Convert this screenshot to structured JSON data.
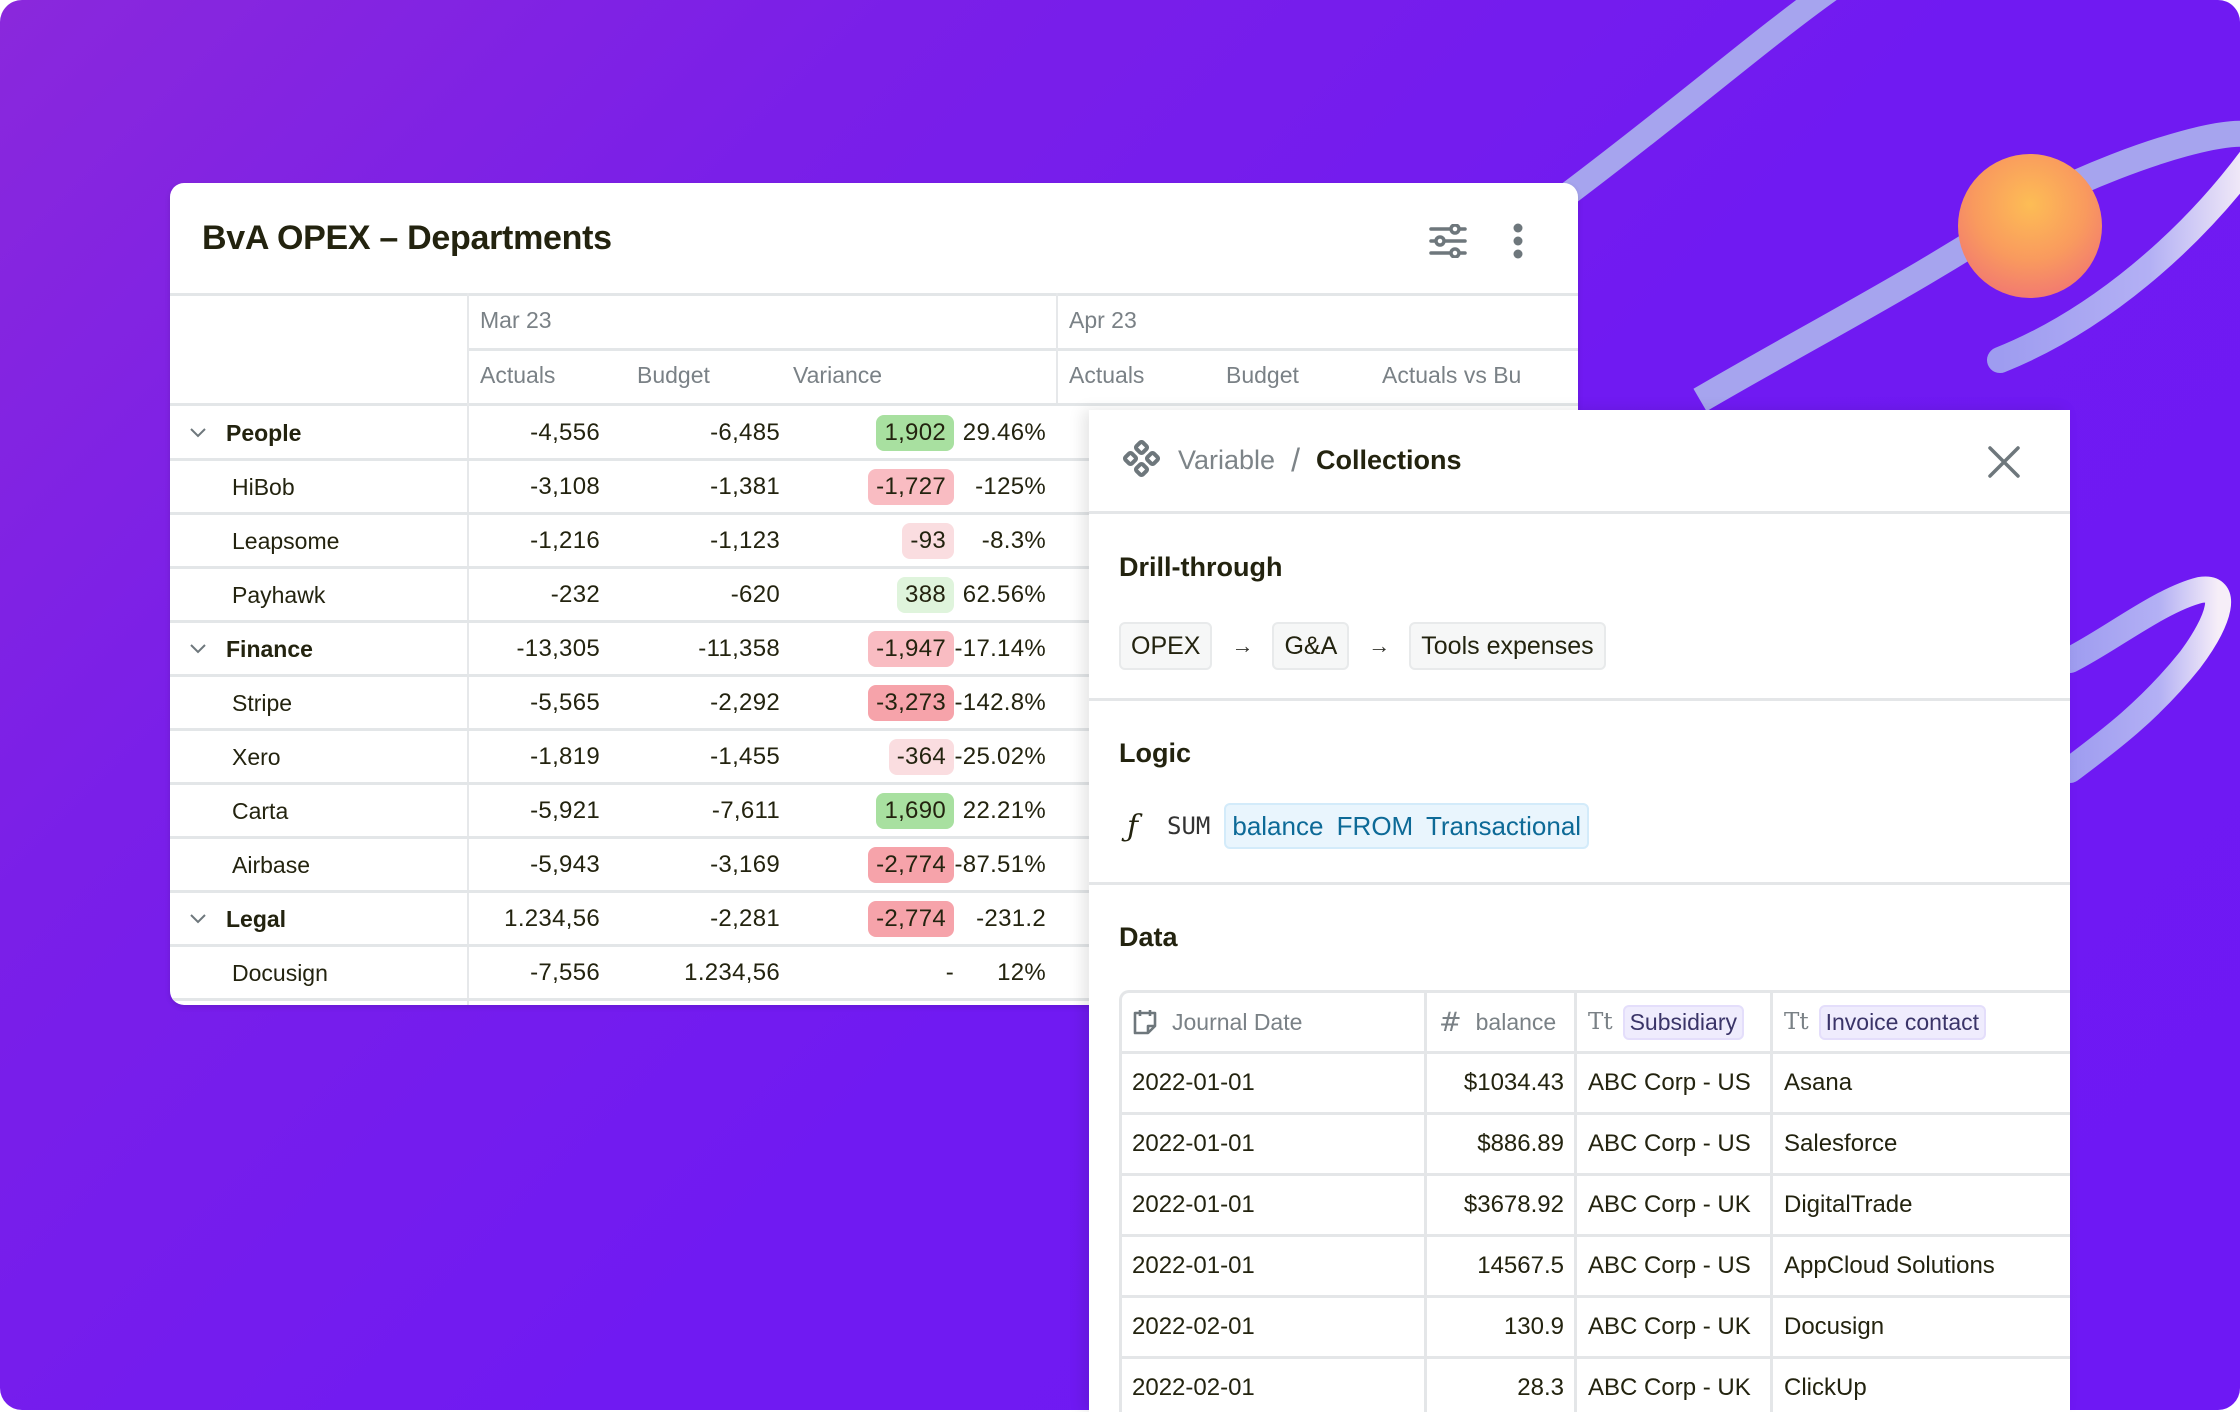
{
  "card": {
    "title": "BvA OPEX – Departments",
    "periods": [
      {
        "label": "Mar 23",
        "columns": [
          "Actuals",
          "Budget",
          "Variance"
        ]
      },
      {
        "label": "Apr 23",
        "columns": [
          "Actuals",
          "Budget",
          "Actuals vs Bu"
        ]
      }
    ],
    "rows": [
      {
        "label": "People",
        "group": true,
        "actuals": "-4,556",
        "budget": "-6,485",
        "variance": "1,902",
        "variance_tone": "green-strong",
        "pct": "29.46%"
      },
      {
        "label": "HiBob",
        "group": false,
        "actuals": "-3,108",
        "budget": "-1,381",
        "variance": "-1,727",
        "variance_tone": "red-med",
        "pct": "-125%"
      },
      {
        "label": "Leapsome",
        "group": false,
        "actuals": "-1,216",
        "budget": "-1,123",
        "variance": "-93",
        "variance_tone": "red-light",
        "pct": "-8.3%"
      },
      {
        "label": "Payhawk",
        "group": false,
        "actuals": "-232",
        "budget": "-620",
        "variance": "388",
        "variance_tone": "green-light",
        "pct": "62.56%"
      },
      {
        "label": "Finance",
        "group": true,
        "actuals": "-13,305",
        "budget": "-11,358",
        "variance": "-1,947",
        "variance_tone": "red-med",
        "pct": "-17.14%"
      },
      {
        "label": "Stripe",
        "group": false,
        "actuals": "-5,565",
        "budget": "-2,292",
        "variance": "-3,273",
        "variance_tone": "red-strong",
        "pct": "-142.8%"
      },
      {
        "label": "Xero",
        "group": false,
        "actuals": "-1,819",
        "budget": "-1,455",
        "variance": "-364",
        "variance_tone": "red-light",
        "pct": "-25.02%"
      },
      {
        "label": "Carta",
        "group": false,
        "actuals": "-5,921",
        "budget": "-7,611",
        "variance": "1,690",
        "variance_tone": "green-strong",
        "pct": "22.21%"
      },
      {
        "label": "Airbase",
        "group": false,
        "actuals": "-5,943",
        "budget": "-3,169",
        "variance": "-2,774",
        "variance_tone": "red-strong",
        "pct": "-87.51%"
      },
      {
        "label": "Legal",
        "group": true,
        "actuals": "1.234,56",
        "budget": "-2,281",
        "variance": "-2,774",
        "variance_tone": "red-strong",
        "pct": "-231.2"
      },
      {
        "label": "Docusign",
        "group": false,
        "actuals": "-7,556",
        "budget": "1.234,56",
        "variance": "-",
        "variance_tone": "",
        "pct": "12%"
      }
    ]
  },
  "panel": {
    "breadcrumb": {
      "parent": "Variable",
      "separator": "/",
      "current": "Collections"
    },
    "drill": {
      "title": "Drill-through",
      "path": [
        "OPEX",
        "G&A",
        "Tools expenses"
      ],
      "arrow": "→"
    },
    "logic": {
      "title": "Logic",
      "fn_icon": "ƒ",
      "fn": "SUM",
      "expression": "balance  FROM Transactional"
    },
    "data": {
      "title": "Data",
      "columns": [
        {
          "label": "Journal Date",
          "icon": "calendar-icon"
        },
        {
          "label": "balance",
          "icon": "hash-icon",
          "icon_glyph": "#"
        },
        {
          "label": "Subsidiary",
          "icon": "text-type-icon",
          "icon_glyph": "Tt"
        },
        {
          "label": "Invoice contact",
          "icon": "text-type-icon",
          "icon_glyph": "Tt"
        }
      ],
      "rows": [
        [
          "2022-01-01",
          "$1034.43",
          "ABC Corp - US",
          "Asana"
        ],
        [
          "2022-01-01",
          "$886.89",
          "ABC Corp - US",
          "Salesforce"
        ],
        [
          "2022-01-01",
          "$3678.92",
          "ABC Corp - UK",
          "DigitalTrade"
        ],
        [
          "2022-01-01",
          "14567.5",
          "ABC Corp - US",
          "AppCloud Solutions"
        ],
        [
          "2022-02-01",
          "130.9",
          "ABC Corp - UK",
          "Docusign"
        ],
        [
          "2022-02-01",
          "28.3",
          "ABC Corp - UK",
          "ClickUp"
        ]
      ]
    }
  },
  "colors": {
    "background": "#7019f0",
    "positive_strong": "#a8e0a0",
    "positive_light": "#dff4dc",
    "negative_strong": "#f6a3aa",
    "negative_medium": "#f9bcc2",
    "negative_light": "#fadde0",
    "expression_text": "#0d6a97",
    "accent_orb": "#fbb44f"
  }
}
